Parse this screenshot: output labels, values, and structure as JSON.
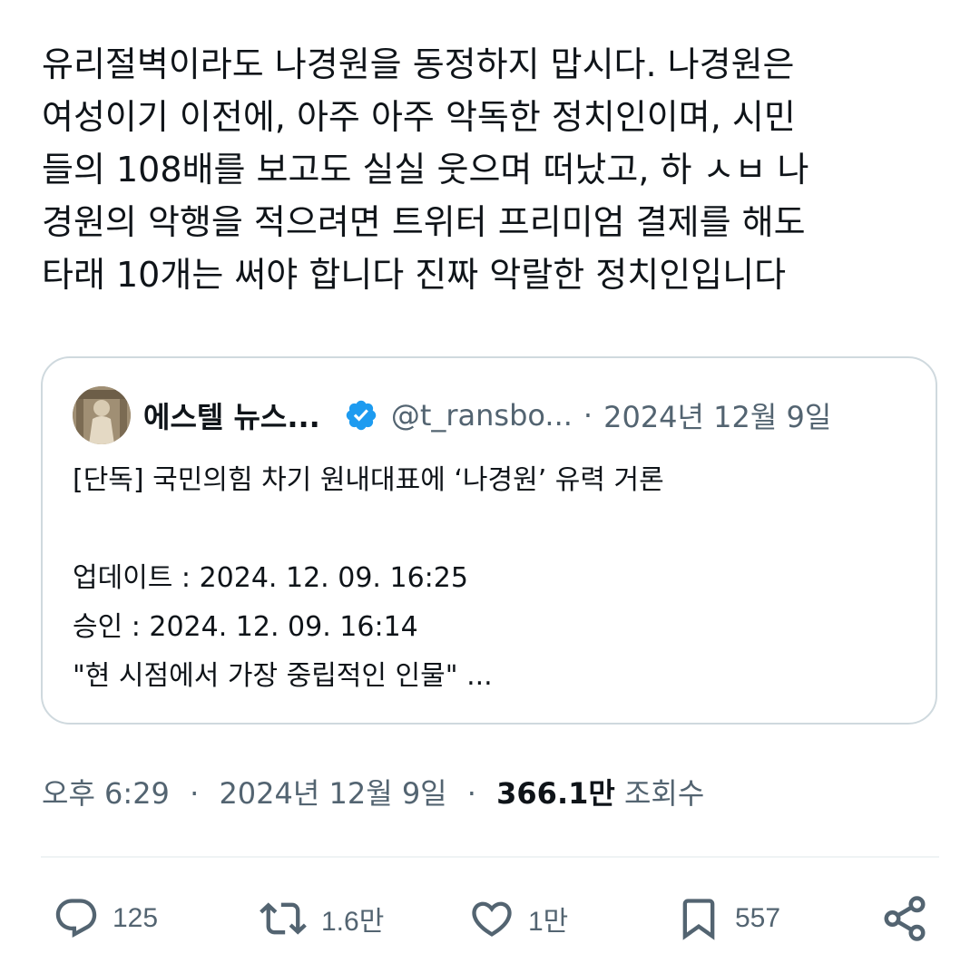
{
  "tweet": {
    "text_lines": [
      "유리절벽이라도 나경원을 동정하지 맙시다. 나경원은",
      "여성이기 이전에, 아주 아주 악독한 정치인이며, 시민",
      "들의 108배를 보고도 실실 웃으며 떠났고, 하 ㅅㅂ 나",
      "경원의 악행을 적으려면 트위터 프리미엄 결제를 해도",
      "타래 10개는 써야 합니다 진짜 악랄한 정치인입니다"
    ]
  },
  "quote": {
    "name": "에스텔 뉴스...",
    "handle": "@t_ransbo...",
    "separator": "·",
    "date": "2024년 12월 9일",
    "headline": "[단독] 국민의힘 차기 원내대표에 ‘나경원’ 유력 거론",
    "update_line": "업데이트 : 2024. 12. 09. 16:25",
    "approve_line": "승인 : 2024. 12. 09. 16:14",
    "excerpt": "\"현 시점에서 가장 중립적인 인물\" ..."
  },
  "meta": {
    "time": "오후 6:29",
    "separator": "·",
    "date": "2024년 12월 9일",
    "views_count": "366.1만",
    "views_label": "조회수"
  },
  "actions": {
    "replies": "125",
    "retweets": "1.6만",
    "likes": "1만",
    "bookmarks": "557"
  },
  "icons": {
    "reply": "reply-icon",
    "retweet": "retweet-icon",
    "like": "heart-icon",
    "bookmark": "bookmark-icon",
    "share": "share-icon",
    "verified": "verified-badge-icon"
  },
  "colors": {
    "text": "#0f1419",
    "secondary": "#536471",
    "border": "#cfd9de",
    "verified": "#1d9bf0"
  }
}
